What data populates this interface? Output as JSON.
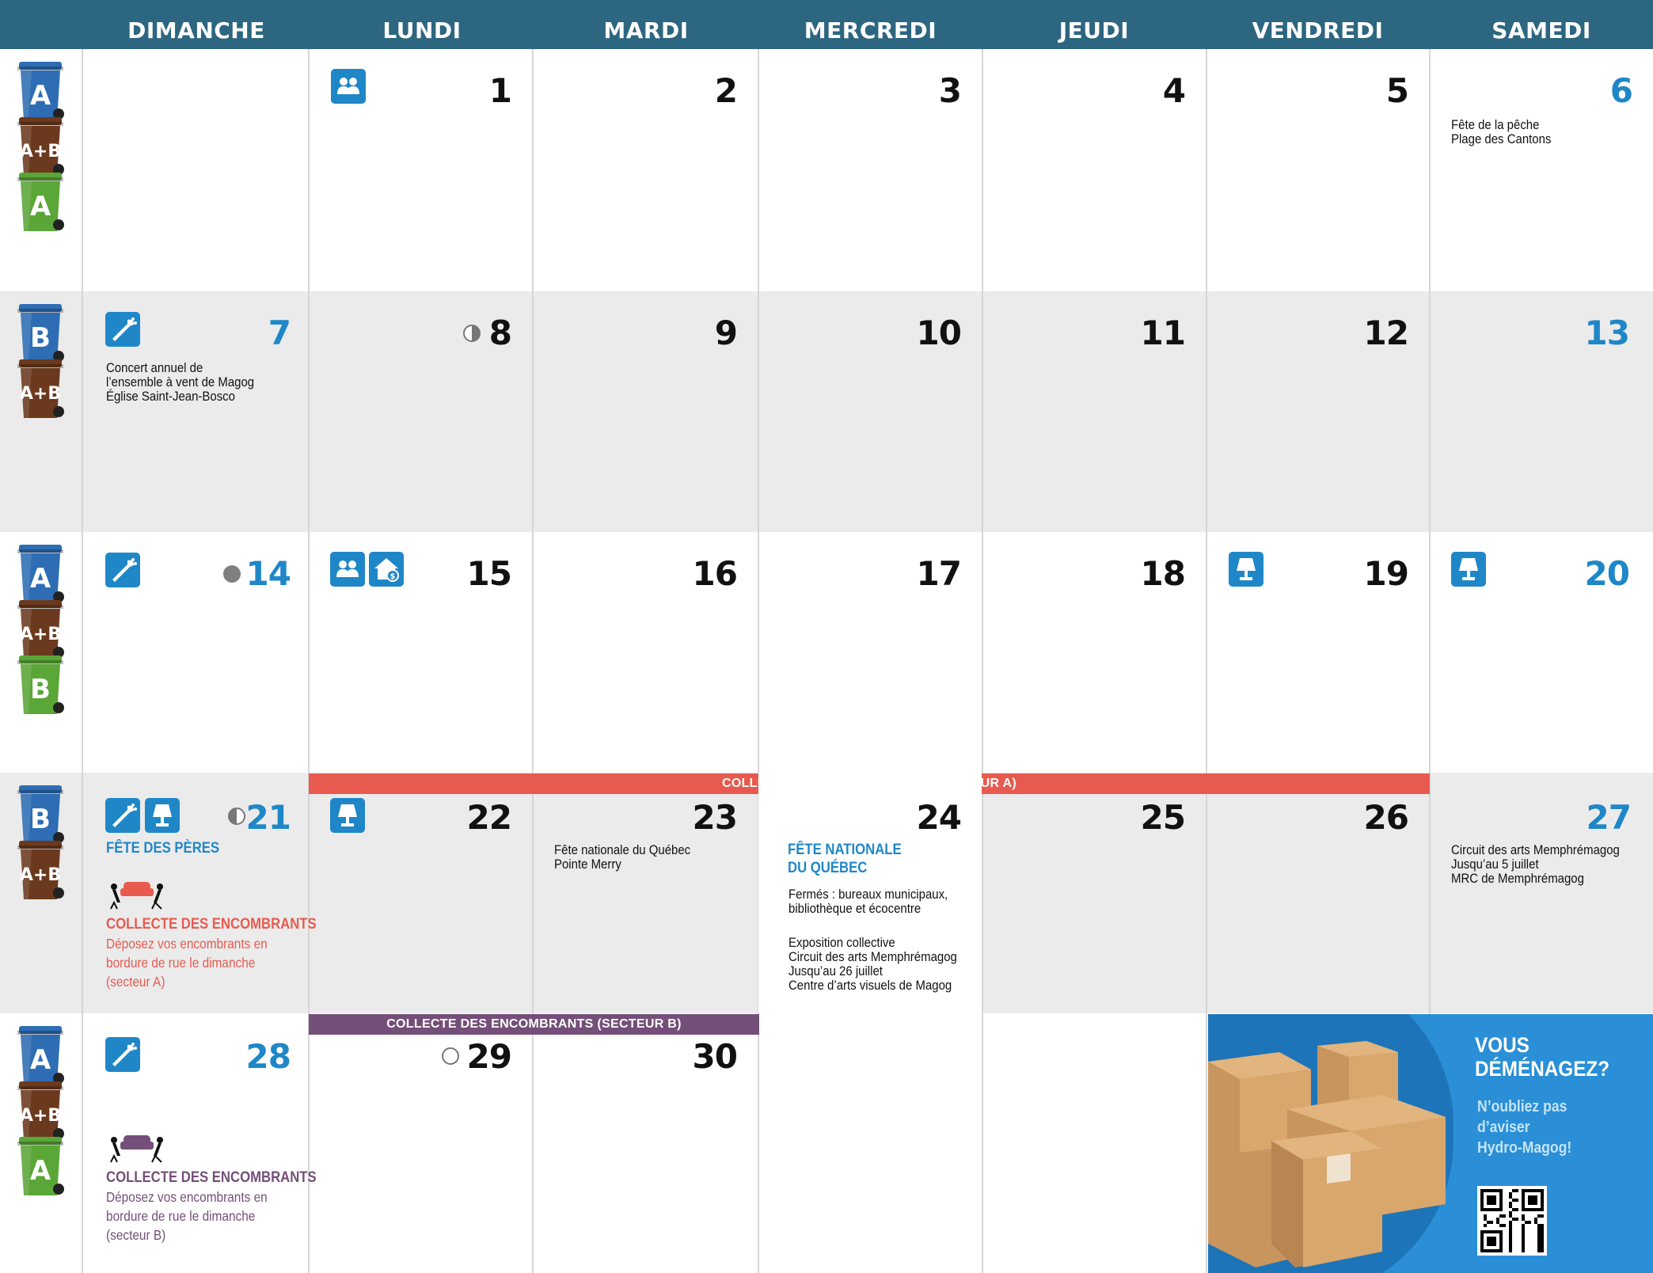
{
  "weekdays": [
    "DIMANCHE",
    "LUNDI",
    "MARDI",
    "MERCREDI",
    "JEUDI",
    "VENDREDI",
    "SAMEDI"
  ],
  "colors": {
    "header": "#2d6680",
    "accent_blue": "#1f87c7",
    "sector_a_red": "#e85a4f",
    "sector_b_purple": "#744f79",
    "bin_blue": "#2e6db3",
    "bin_brown": "#6b3a1e",
    "bin_green": "#5aa637",
    "promo_blue": "#2a8fd6"
  },
  "bins": {
    "week1": [
      "A",
      "A+B",
      "A"
    ],
    "week2": [
      "B",
      "A+B"
    ],
    "week3": [
      "A",
      "A+B",
      "B"
    ],
    "week4": [
      "B",
      "A+B"
    ],
    "week5": [
      "A",
      "A+B",
      "A"
    ]
  },
  "days": {
    "d1": "1",
    "d2": "2",
    "d3": "3",
    "d4": "4",
    "d5": "5",
    "d6": "6",
    "d7": "7",
    "d8": "8",
    "d9": "9",
    "d10": "10",
    "d11": "11",
    "d12": "12",
    "d13": "13",
    "d14": "14",
    "d15": "15",
    "d16": "16",
    "d17": "17",
    "d18": "18",
    "d19": "19",
    "d20": "20",
    "d21": "21",
    "d22": "22",
    "d23": "23",
    "d24": "24",
    "d25": "25",
    "d26": "26",
    "d27": "27",
    "d28": "28",
    "d29": "29",
    "d30": "30"
  },
  "events": {
    "d6": [
      "Fête de la pêche",
      "Plage des Cantons"
    ],
    "d7": [
      "Concert annuel de",
      "l’ensemble à vent de Magog",
      "Église Saint-Jean-Bosco"
    ],
    "d21_title": "FÊTE DES PÈRES",
    "d23": [
      "Fête nationale du Québec",
      "Pointe Merry"
    ],
    "d24_title": [
      "FÊTE NATIONALE",
      "DU QUÉBEC"
    ],
    "d24_closed": [
      "Fermés : bureaux municipaux,",
      "bibliothèque et écocentre"
    ],
    "d24_expo": [
      "Exposition collective",
      "Circuit des arts Memphrémagog",
      "Jusqu’au 26 juillet",
      "Centre d’arts visuels de Magog"
    ],
    "d27": [
      "Circuit des arts Memphrémagog",
      "Jusqu’au 5 juillet",
      "MRC de Memphrémagog"
    ]
  },
  "bulky": {
    "title": "COLLECTE DES ENCOMBRANTS",
    "sector_a_text": [
      "Déposez vos encombrants en",
      "bordure de rue le dimanche",
      "(secteur A)"
    ],
    "sector_b_text": [
      "Déposez vos encombrants en",
      "bordure de rue le dimanche",
      "(secteur B)"
    ],
    "banner_a": "COLLECTE DES ENCOMBRANTS (SECTEUR A)",
    "banner_b": "COLLECTE DES ENCOMBRANTS (SECTEUR B)"
  },
  "promo": {
    "title": [
      "VOUS",
      "DÉMÉNAGEZ?"
    ],
    "subtitle": [
      "N’oubliez pas",
      "d’aviser",
      "Hydro-Magog!"
    ]
  },
  "icons": {
    "council": "council-meeting-icon",
    "music": "music-event-icon",
    "lamp": "library-lamp-icon",
    "house": "house-tax-icon",
    "moon_first": "first-quarter-moon-icon",
    "moon_full": "full-moon-icon",
    "moon_last": "last-quarter-moon-icon",
    "moon_new": "new-moon-icon"
  }
}
